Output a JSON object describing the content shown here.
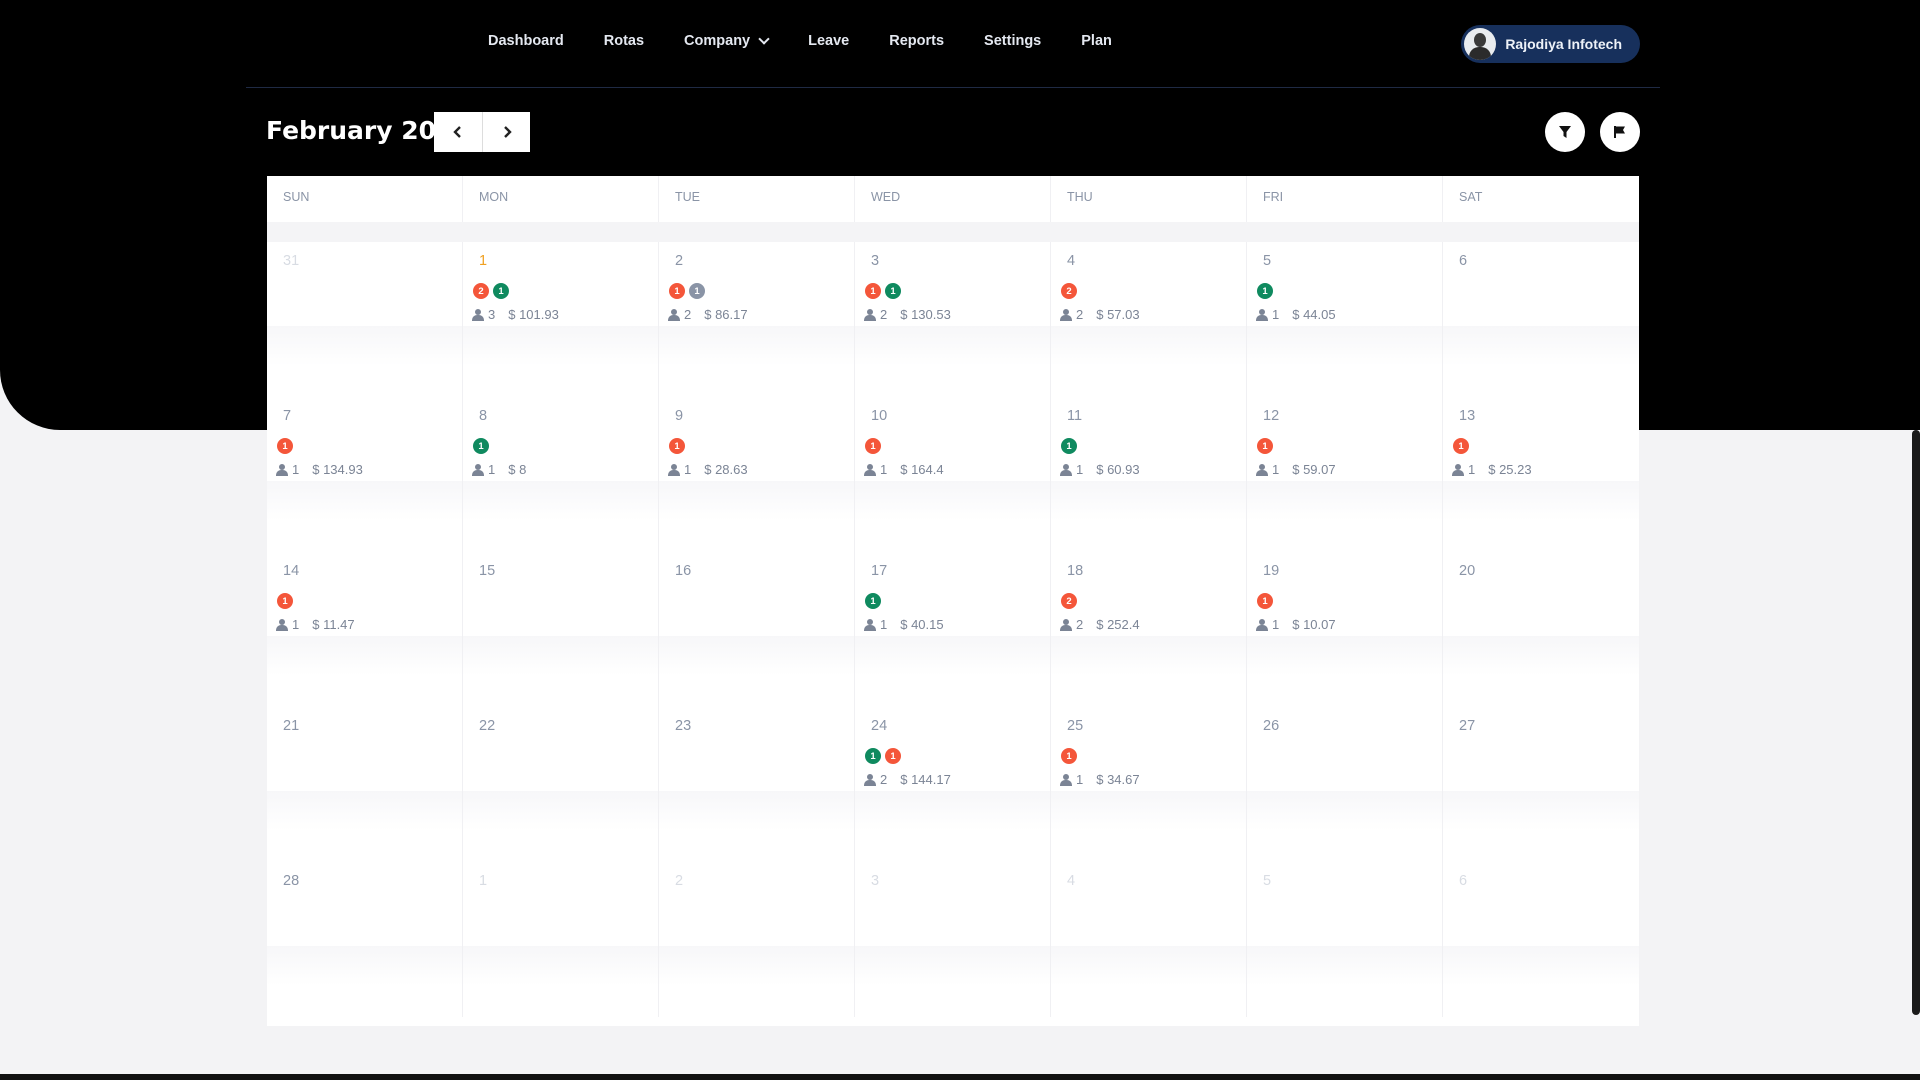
{
  "nav": {
    "links": [
      "Dashboard",
      "Rotas",
      "Company",
      "Leave",
      "Reports",
      "Settings",
      "Plan"
    ],
    "user_name": "Rajodiya Infotech"
  },
  "calendar": {
    "title": "February 2021",
    "prev_icon": "chevron-left-icon",
    "next_icon": "chevron-right-icon",
    "filter_icon": "filter-icon",
    "flag_icon": "flag-icon",
    "weekdays": [
      "SUN",
      "MON",
      "TUE",
      "WED",
      "THU",
      "FRI",
      "SAT"
    ],
    "colors": {
      "red": "#f4563a",
      "green": "#0f8a5f",
      "gray": "#8a94a6",
      "today": "#f0a020"
    },
    "weeks": [
      [
        {
          "d": "31",
          "muted": true
        },
        {
          "d": "1",
          "today": true,
          "badges": [
            {
              "n": "2",
              "c": "red"
            },
            {
              "n": "1",
              "c": "green"
            }
          ],
          "people": "3",
          "amount": "$ 101.93"
        },
        {
          "d": "2",
          "badges": [
            {
              "n": "1",
              "c": "red"
            },
            {
              "n": "1",
              "c": "gray"
            }
          ],
          "people": "2",
          "amount": "$ 86.17"
        },
        {
          "d": "3",
          "badges": [
            {
              "n": "1",
              "c": "red"
            },
            {
              "n": "1",
              "c": "green"
            }
          ],
          "people": "2",
          "amount": "$ 130.53"
        },
        {
          "d": "4",
          "badges": [
            {
              "n": "2",
              "c": "red"
            }
          ],
          "people": "2",
          "amount": "$ 57.03"
        },
        {
          "d": "5",
          "badges": [
            {
              "n": "1",
              "c": "green"
            }
          ],
          "people": "1",
          "amount": "$ 44.05"
        },
        {
          "d": "6"
        }
      ],
      [
        {
          "d": "7",
          "badges": [
            {
              "n": "1",
              "c": "red"
            }
          ],
          "people": "1",
          "amount": "$ 134.93"
        },
        {
          "d": "8",
          "badges": [
            {
              "n": "1",
              "c": "green"
            }
          ],
          "people": "1",
          "amount": "$ 8"
        },
        {
          "d": "9",
          "badges": [
            {
              "n": "1",
              "c": "red"
            }
          ],
          "people": "1",
          "amount": "$ 28.63"
        },
        {
          "d": "10",
          "badges": [
            {
              "n": "1",
              "c": "red"
            }
          ],
          "people": "1",
          "amount": "$ 164.4"
        },
        {
          "d": "11",
          "badges": [
            {
              "n": "1",
              "c": "green"
            }
          ],
          "people": "1",
          "amount": "$ 60.93"
        },
        {
          "d": "12",
          "badges": [
            {
              "n": "1",
              "c": "red"
            }
          ],
          "people": "1",
          "amount": "$ 59.07"
        },
        {
          "d": "13",
          "badges": [
            {
              "n": "1",
              "c": "red"
            }
          ],
          "people": "1",
          "amount": "$ 25.23"
        }
      ],
      [
        {
          "d": "14",
          "badges": [
            {
              "n": "1",
              "c": "red"
            }
          ],
          "people": "1",
          "amount": "$ 11.47"
        },
        {
          "d": "15"
        },
        {
          "d": "16"
        },
        {
          "d": "17",
          "badges": [
            {
              "n": "1",
              "c": "green"
            }
          ],
          "people": "1",
          "amount": "$ 40.15"
        },
        {
          "d": "18",
          "badges": [
            {
              "n": "2",
              "c": "red"
            }
          ],
          "people": "2",
          "amount": "$ 252.4"
        },
        {
          "d": "19",
          "badges": [
            {
              "n": "1",
              "c": "red"
            }
          ],
          "people": "1",
          "amount": "$ 10.07"
        },
        {
          "d": "20"
        }
      ],
      [
        {
          "d": "21"
        },
        {
          "d": "22"
        },
        {
          "d": "23"
        },
        {
          "d": "24",
          "badges": [
            {
              "n": "1",
              "c": "green"
            },
            {
              "n": "1",
              "c": "red"
            }
          ],
          "people": "2",
          "amount": "$ 144.17"
        },
        {
          "d": "25",
          "badges": [
            {
              "n": "1",
              "c": "red"
            }
          ],
          "people": "1",
          "amount": "$ 34.67"
        },
        {
          "d": "26"
        },
        {
          "d": "27"
        }
      ],
      [
        {
          "d": "28"
        },
        {
          "d": "1",
          "muted": true
        },
        {
          "d": "2",
          "muted": true
        },
        {
          "d": "3",
          "muted": true
        },
        {
          "d": "4",
          "muted": true
        },
        {
          "d": "5",
          "muted": true
        },
        {
          "d": "6",
          "muted": true
        }
      ]
    ]
  }
}
